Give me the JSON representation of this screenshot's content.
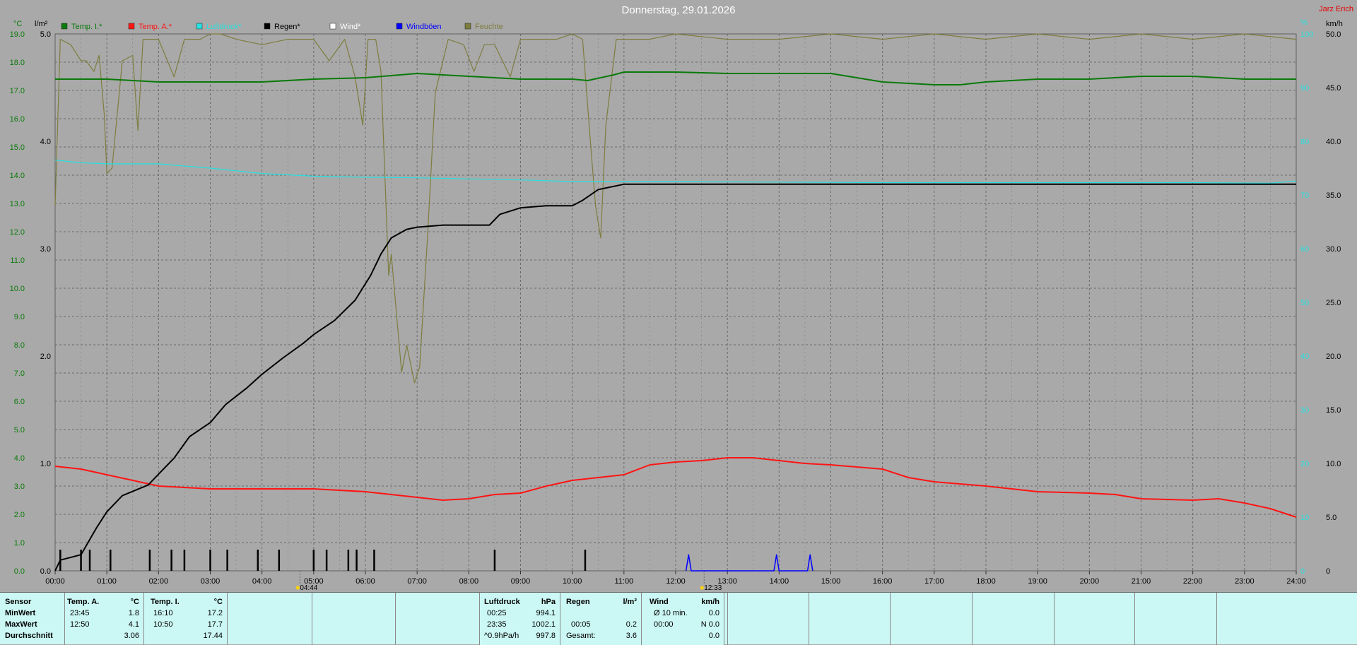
{
  "title": "Donnerstag, 29.01.2026",
  "author": "Jarz Erich",
  "colors": {
    "temp_inside": "#0a7a0a",
    "temp_outside": "#ff1414",
    "pressure": "#27e0e0",
    "rain": "#000000",
    "wind": "#ffffff",
    "gusts": "#0000ff",
    "humidity": "#7d7d3f",
    "accent_red": "#e60000"
  },
  "axes": {
    "left_unit_temp": "°C",
    "left_unit_rain": "l/m²",
    "right_unit_pct": "%",
    "right_unit_wind": "km/h",
    "temp_ticks": [
      "0.0",
      "1.0",
      "2.0",
      "3.0",
      "4.0",
      "5.0",
      "6.0",
      "7.0",
      "8.0",
      "9.0",
      "10.0",
      "11.0",
      "12.0",
      "13.0",
      "14.0",
      "15.0",
      "16.0",
      "17.0",
      "18.0",
      "19.0"
    ],
    "rain_ticks": [
      "1.0",
      "2.0",
      "3.0",
      "4.0",
      "5.0"
    ],
    "wind_ticks": [
      "0",
      "5.0",
      "10.0",
      "15.0",
      "20.0",
      "25.0",
      "30.0",
      "35.0",
      "40.0",
      "45.0",
      "50.0"
    ],
    "pct_ticks": [
      "0",
      "10",
      "20",
      "30",
      "40",
      "50",
      "60",
      "70",
      "80",
      "90",
      "100"
    ],
    "time_ticks": [
      "00:00",
      "01:00",
      "02:00",
      "03:00",
      "04:00",
      "05:00",
      "06:00",
      "07:00",
      "08:00",
      "09:00",
      "10:00",
      "11:00",
      "12:00",
      "13:00",
      "14:00",
      "15:00",
      "16:00",
      "17:00",
      "18:00",
      "19:00",
      "20:00",
      "21:00",
      "22:00",
      "23:00",
      "24:00"
    ],
    "sunrise": "04:44",
    "sunset": "12:33"
  },
  "legend": [
    {
      "label": "Temp. I.*",
      "color": "#0a7a0a"
    },
    {
      "label": "Temp. A.*",
      "color": "#ff1414"
    },
    {
      "label": "Luftdruck*",
      "color": "#27e0e0"
    },
    {
      "label": "Regen*",
      "color": "#000000"
    },
    {
      "label": "Wind*",
      "color": "#ffffff"
    },
    {
      "label": "Windböen",
      "color": "#0000ff"
    },
    {
      "label": "Feuchte",
      "color": "#7d7d3f"
    }
  ],
  "chart_data": {
    "type": "line",
    "x_unit": "hours",
    "xlim": [
      0,
      24
    ],
    "ylim_temp": [
      0,
      19
    ],
    "ylim_rain": [
      0,
      5
    ],
    "ylim_wind": [
      0,
      50
    ],
    "ylim_pct": [
      0,
      100
    ],
    "grid": true,
    "legend_position": "top",
    "series": [
      {
        "name": "Temp. I.*",
        "axis": "temp",
        "points": [
          [
            0,
            17.4
          ],
          [
            1,
            17.4
          ],
          [
            2,
            17.3
          ],
          [
            3,
            17.3
          ],
          [
            4,
            17.3
          ],
          [
            5,
            17.4
          ],
          [
            6,
            17.45
          ],
          [
            7,
            17.6
          ],
          [
            8,
            17.5
          ],
          [
            9,
            17.4
          ],
          [
            10,
            17.4
          ],
          [
            10.3,
            17.35
          ],
          [
            10.8,
            17.55
          ],
          [
            11,
            17.65
          ],
          [
            12,
            17.65
          ],
          [
            13,
            17.6
          ],
          [
            14,
            17.6
          ],
          [
            15,
            17.6
          ],
          [
            16,
            17.3
          ],
          [
            17,
            17.2
          ],
          [
            17.5,
            17.2
          ],
          [
            18,
            17.3
          ],
          [
            19,
            17.4
          ],
          [
            20,
            17.4
          ],
          [
            21,
            17.5
          ],
          [
            22,
            17.5
          ],
          [
            23,
            17.4
          ],
          [
            24,
            17.4
          ]
        ]
      },
      {
        "name": "Temp. A.*",
        "axis": "temp",
        "points": [
          [
            0,
            3.7
          ],
          [
            0.5,
            3.6
          ],
          [
            1,
            3.4
          ],
          [
            1.5,
            3.2
          ],
          [
            2,
            3.0
          ],
          [
            2.5,
            2.95
          ],
          [
            3,
            2.9
          ],
          [
            4,
            2.9
          ],
          [
            5,
            2.9
          ],
          [
            6,
            2.8
          ],
          [
            7,
            2.6
          ],
          [
            7.5,
            2.5
          ],
          [
            8,
            2.55
          ],
          [
            8.5,
            2.7
          ],
          [
            9,
            2.75
          ],
          [
            9.5,
            3.0
          ],
          [
            10,
            3.2
          ],
          [
            10.5,
            3.3
          ],
          [
            11,
            3.4
          ],
          [
            11.5,
            3.75
          ],
          [
            12,
            3.85
          ],
          [
            12.5,
            3.9
          ],
          [
            13,
            4.0
          ],
          [
            13.5,
            4.0
          ],
          [
            14,
            3.9
          ],
          [
            14.5,
            3.8
          ],
          [
            15,
            3.75
          ],
          [
            16,
            3.6
          ],
          [
            16.5,
            3.3
          ],
          [
            17,
            3.15
          ],
          [
            18,
            3.0
          ],
          [
            18.5,
            2.9
          ],
          [
            19,
            2.8
          ],
          [
            20,
            2.75
          ],
          [
            20.5,
            2.7
          ],
          [
            21,
            2.55
          ],
          [
            22,
            2.5
          ],
          [
            22.5,
            2.55
          ],
          [
            23,
            2.4
          ],
          [
            23.5,
            2.2
          ],
          [
            24,
            1.9
          ]
        ]
      },
      {
        "name": "Luftdruck*",
        "axis": "pct",
        "points": [
          [
            0,
            76.5
          ],
          [
            0.5,
            76
          ],
          [
            1,
            75.8
          ],
          [
            2,
            75.8
          ],
          [
            2.5,
            75.4
          ],
          [
            3,
            75
          ],
          [
            4,
            74
          ],
          [
            5,
            73.5
          ],
          [
            6,
            73.3
          ],
          [
            7,
            73.2
          ],
          [
            8,
            73
          ],
          [
            9,
            72.8
          ],
          [
            10,
            72.5
          ],
          [
            11,
            72.5
          ],
          [
            12,
            72.5
          ],
          [
            14,
            72.4
          ],
          [
            16,
            72.3
          ],
          [
            18,
            72.3
          ],
          [
            20,
            72.3
          ],
          [
            22,
            72.3
          ],
          [
            23.5,
            72.2
          ],
          [
            24,
            72.6
          ]
        ]
      },
      {
        "name": "Regen*",
        "axis": "rain",
        "points": [
          [
            0,
            0
          ],
          [
            0.1,
            0.1
          ],
          [
            0.5,
            0.15
          ],
          [
            0.8,
            0.4
          ],
          [
            1,
            0.55
          ],
          [
            1.3,
            0.7
          ],
          [
            1.8,
            0.8
          ],
          [
            2,
            0.9
          ],
          [
            2.3,
            1.05
          ],
          [
            2.6,
            1.25
          ],
          [
            3,
            1.38
          ],
          [
            3.3,
            1.55
          ],
          [
            3.7,
            1.7
          ],
          [
            4,
            1.83
          ],
          [
            4.4,
            1.98
          ],
          [
            4.8,
            2.12
          ],
          [
            5,
            2.2
          ],
          [
            5.4,
            2.33
          ],
          [
            5.8,
            2.52
          ],
          [
            6.1,
            2.75
          ],
          [
            6.3,
            2.95
          ],
          [
            6.5,
            3.1
          ],
          [
            6.8,
            3.18
          ],
          [
            7,
            3.2
          ],
          [
            7.5,
            3.22
          ],
          [
            8,
            3.22
          ],
          [
            8.4,
            3.22
          ],
          [
            8.6,
            3.32
          ],
          [
            9,
            3.38
          ],
          [
            9.5,
            3.4
          ],
          [
            10,
            3.4
          ],
          [
            10.2,
            3.45
          ],
          [
            10.5,
            3.55
          ],
          [
            11,
            3.6
          ],
          [
            12,
            3.6
          ],
          [
            24,
            3.6
          ]
        ]
      },
      {
        "name": "Windböen",
        "axis": "wind",
        "points": [
          [
            12.2,
            0
          ],
          [
            12.25,
            1.5
          ],
          [
            12.3,
            0
          ],
          [
            13.9,
            0
          ],
          [
            13.95,
            1.5
          ],
          [
            14.0,
            0
          ],
          [
            14.55,
            0
          ],
          [
            14.6,
            1.5
          ],
          [
            14.65,
            0
          ]
        ]
      },
      {
        "name": "Feuchte",
        "axis": "pct",
        "points": [
          [
            0,
            68
          ],
          [
            0.1,
            99
          ],
          [
            0.3,
            98
          ],
          [
            0.5,
            95
          ],
          [
            0.6,
            95
          ],
          [
            0.75,
            93
          ],
          [
            0.85,
            96
          ],
          [
            0.95,
            85
          ],
          [
            1,
            74
          ],
          [
            1.1,
            75
          ],
          [
            1.3,
            95
          ],
          [
            1.5,
            96
          ],
          [
            1.6,
            82
          ],
          [
            1.7,
            99
          ],
          [
            2,
            99
          ],
          [
            2.3,
            92
          ],
          [
            2.5,
            99
          ],
          [
            2.8,
            99
          ],
          [
            3,
            100
          ],
          [
            3.2,
            100
          ],
          [
            3.5,
            99
          ],
          [
            4,
            98
          ],
          [
            4.5,
            99
          ],
          [
            5,
            99
          ],
          [
            5.3,
            95
          ],
          [
            5.6,
            99
          ],
          [
            5.8,
            92
          ],
          [
            5.95,
            83
          ],
          [
            6.05,
            99
          ],
          [
            6.2,
            99
          ],
          [
            6.3,
            93
          ],
          [
            6.45,
            55
          ],
          [
            6.5,
            59
          ],
          [
            6.7,
            37
          ],
          [
            6.8,
            42
          ],
          [
            6.95,
            35
          ],
          [
            7.05,
            38
          ],
          [
            7.2,
            62
          ],
          [
            7.35,
            89
          ],
          [
            7.5,
            95
          ],
          [
            7.6,
            99
          ],
          [
            7.9,
            98
          ],
          [
            8.1,
            93
          ],
          [
            8.3,
            98
          ],
          [
            8.5,
            98
          ],
          [
            8.8,
            92
          ],
          [
            9,
            99
          ],
          [
            9.3,
            99
          ],
          [
            9.7,
            99
          ],
          [
            10,
            100
          ],
          [
            10.2,
            99
          ],
          [
            10.35,
            80
          ],
          [
            10.45,
            68
          ],
          [
            10.55,
            62
          ],
          [
            10.65,
            83
          ],
          [
            10.85,
            99
          ],
          [
            11,
            99
          ],
          [
            11.5,
            99
          ],
          [
            12,
            100
          ],
          [
            13,
            99
          ],
          [
            14,
            99
          ],
          [
            15,
            100
          ],
          [
            16,
            99
          ],
          [
            17,
            100
          ],
          [
            18,
            99
          ],
          [
            19,
            100
          ],
          [
            20,
            99
          ],
          [
            21,
            100
          ],
          [
            22,
            99
          ],
          [
            23,
            100
          ],
          [
            24,
            99
          ]
        ]
      }
    ],
    "rain_events": [
      0.1,
      0.5,
      0.67,
      1.07,
      1.83,
      2.25,
      2.5,
      3.0,
      3.33,
      3.92,
      4.33,
      5.0,
      5.25,
      5.67,
      5.83,
      6.17,
      8.5,
      10.25
    ],
    "stats": {
      "headers": {
        "sensor": "Sensor",
        "temp_a": "Temp. A.",
        "temp_a_unit": "°C",
        "temp_i": "Temp. I.",
        "temp_i_unit": "°C",
        "pressure": "Luftdruck",
        "pressure_unit": "hPa",
        "rain": "Regen",
        "rain_unit": "l/m²",
        "wind": "Wind",
        "wind_unit": "km/h"
      },
      "rows": [
        {
          "label": "MinWert",
          "temp_a_time": "23:45",
          "temp_a_val": "1.8",
          "temp_i_time": "16:10",
          "temp_i_val": "17.2",
          "pressure_time": "00:25",
          "pressure_val": "994.1",
          "rain_time": "",
          "rain_val": "",
          "wind_time": "Ø 10 min.",
          "wind_val": "0.0"
        },
        {
          "label": "MaxWert",
          "temp_a_time": "12:50",
          "temp_a_val": "4.1",
          "temp_i_time": "10:50",
          "temp_i_val": "17.7",
          "pressure_time": "23:35",
          "pressure_val": "1002.1",
          "rain_time": "00:05",
          "rain_val": "0.2",
          "wind_time": "00:00",
          "wind_val": "N 0.0"
        },
        {
          "label": "Durchschnitt",
          "temp_a_time": "",
          "temp_a_val": "3.06",
          "temp_i_time": "",
          "temp_i_val": "17.44",
          "pressure_time": "^0.9hPa/h",
          "pressure_val": "997.8",
          "rain_time": "Gesamt:",
          "rain_val": "3.6",
          "wind_time": "",
          "wind_val": "0.0"
        }
      ]
    }
  }
}
